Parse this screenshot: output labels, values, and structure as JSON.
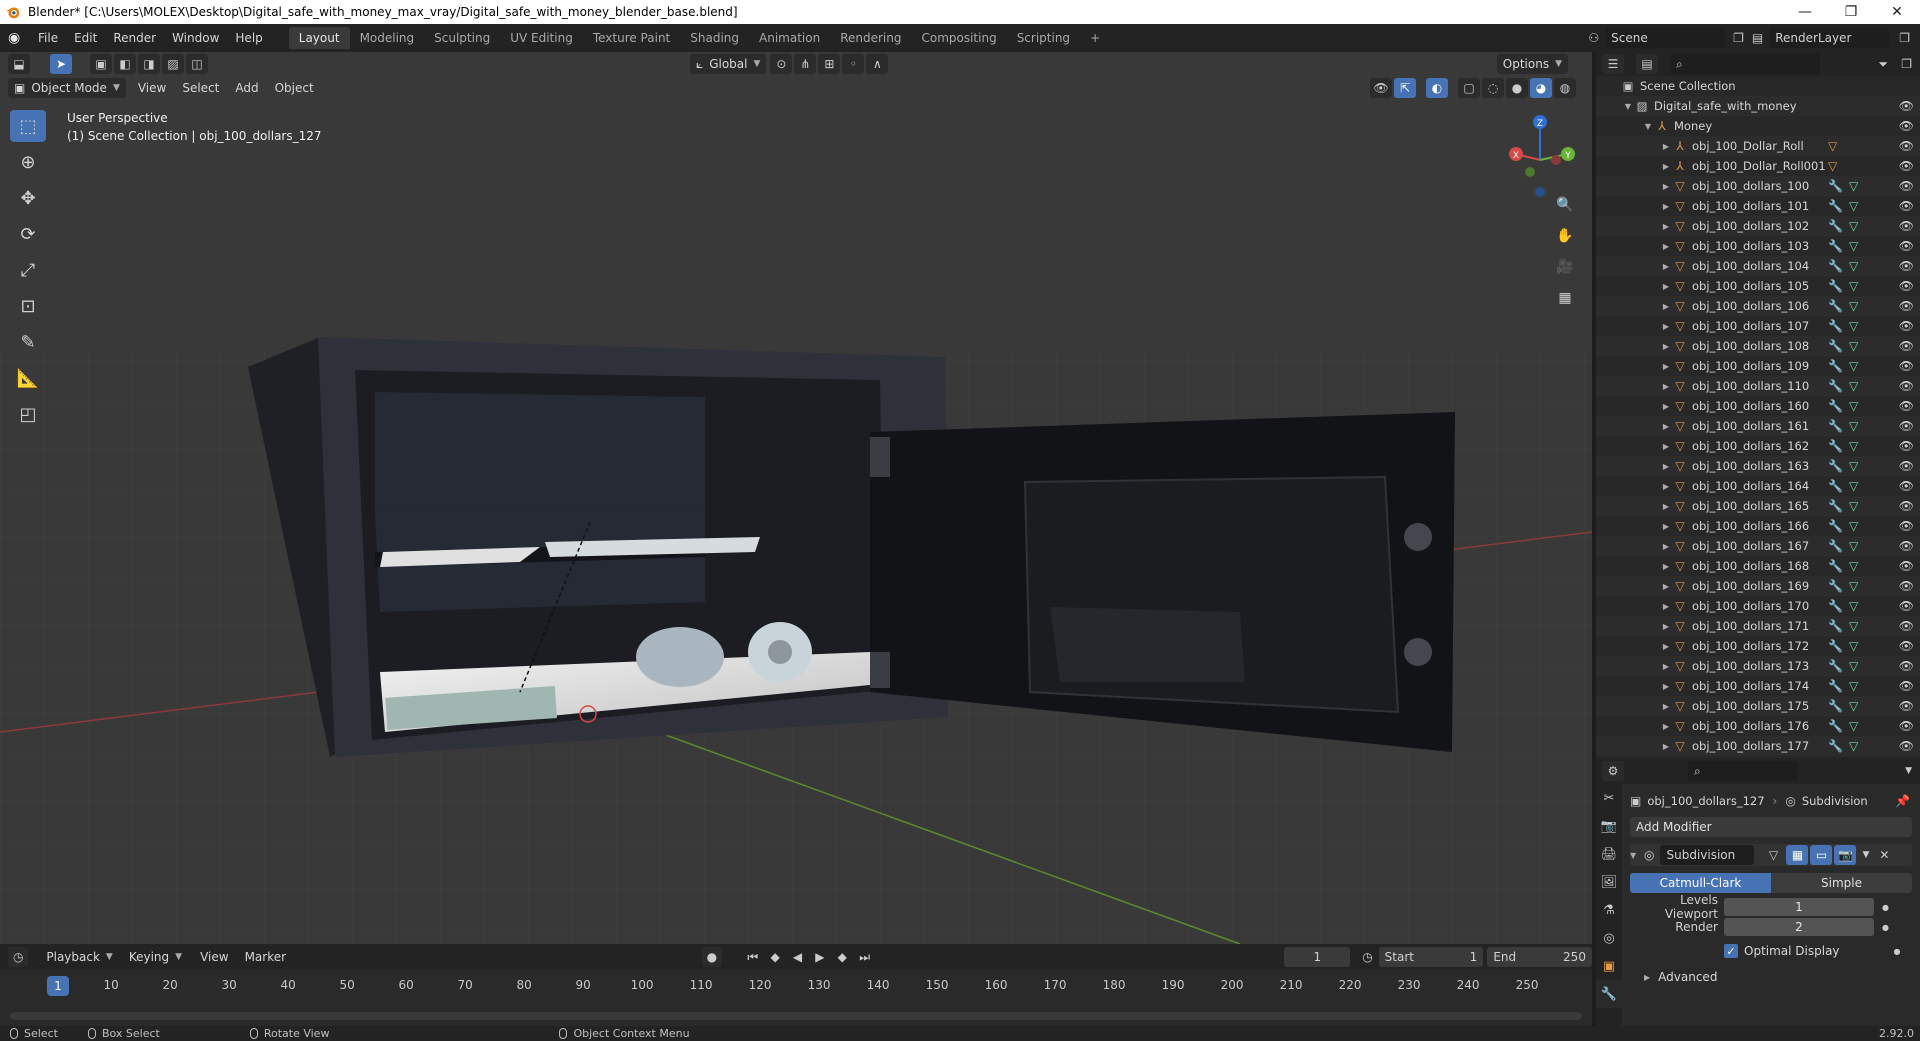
{
  "window": {
    "title": "Blender* [C:\\Users\\MOLEX\\Desktop\\Digital_safe_with_money_max_vray/Digital_safe_with_money_blender_base.blend]",
    "minimize": "—",
    "maximize": "❐",
    "close": "✕"
  },
  "menubar": {
    "items": [
      "File",
      "Edit",
      "Render",
      "Window",
      "Help"
    ],
    "workspaces": [
      "Layout",
      "Modeling",
      "Sculpting",
      "UV Editing",
      "Texture Paint",
      "Shading",
      "Animation",
      "Rendering",
      "Compositing",
      "Scripting"
    ],
    "add_workspace": "+",
    "scene": "Scene",
    "render_layer": "RenderLayer"
  },
  "viewport": {
    "mode": "Object Mode",
    "menu": [
      "View",
      "Select",
      "Add",
      "Object"
    ],
    "transform_orientation": "Global",
    "options": "Options",
    "perspective": "User Perspective",
    "collection_info": "(1) Scene Collection | obj_100_dollars_127",
    "gizmo": {
      "x": "X",
      "y": "Y",
      "z": "Z"
    }
  },
  "timeline": {
    "menu": [
      "Playback",
      "Keying",
      "View",
      "Marker"
    ],
    "current_frame": "1",
    "start_label": "Start",
    "start": "1",
    "end_label": "End",
    "end": "250",
    "ticks": [
      "10",
      "20",
      "30",
      "40",
      "50",
      "60",
      "70",
      "80",
      "90",
      "100",
      "110",
      "120",
      "130",
      "140",
      "150",
      "160",
      "170",
      "180",
      "190",
      "200",
      "210",
      "220",
      "230",
      "240",
      "250"
    ],
    "indicator": "1"
  },
  "statusbar": {
    "select": "Select",
    "box_select": "Box Select",
    "rotate_view": "Rotate View",
    "context_menu": "Object Context Menu",
    "version": "2.92.0"
  },
  "outliner": {
    "scene_collection": "Scene Collection",
    "collection": "Digital_safe_with_money",
    "group": "Money",
    "rolls": [
      "obj_100_Dollar_Roll",
      "obj_100_Dollar_Roll001"
    ],
    "objects": [
      "obj_100_dollars_100",
      "obj_100_dollars_101",
      "obj_100_dollars_102",
      "obj_100_dollars_103",
      "obj_100_dollars_104",
      "obj_100_dollars_105",
      "obj_100_dollars_106",
      "obj_100_dollars_107",
      "obj_100_dollars_108",
      "obj_100_dollars_109",
      "obj_100_dollars_110",
      "obj_100_dollars_160",
      "obj_100_dollars_161",
      "obj_100_dollars_162",
      "obj_100_dollars_163",
      "obj_100_dollars_164",
      "obj_100_dollars_165",
      "obj_100_dollars_166",
      "obj_100_dollars_167",
      "obj_100_dollars_168",
      "obj_100_dollars_169",
      "obj_100_dollars_170",
      "obj_100_dollars_171",
      "obj_100_dollars_172",
      "obj_100_dollars_173",
      "obj_100_dollars_174",
      "obj_100_dollars_175",
      "obj_100_dollars_176",
      "obj_100_dollars_177"
    ]
  },
  "properties": {
    "object": "obj_100_dollars_127",
    "modifier_breadcrumb": "Subdivision",
    "add_modifier": "Add Modifier",
    "modifier_name": "Subdivision",
    "catmull": "Catmull-Clark",
    "simple": "Simple",
    "levels_viewport_label": "Levels Viewport",
    "levels_viewport": "1",
    "render_label": "Render",
    "render": "2",
    "optimal_display": "Optimal Display",
    "advanced": "Advanced"
  },
  "colors": {
    "accent": "#4772b3",
    "viewport_bg": "#393939",
    "panel_bg": "#282828"
  }
}
